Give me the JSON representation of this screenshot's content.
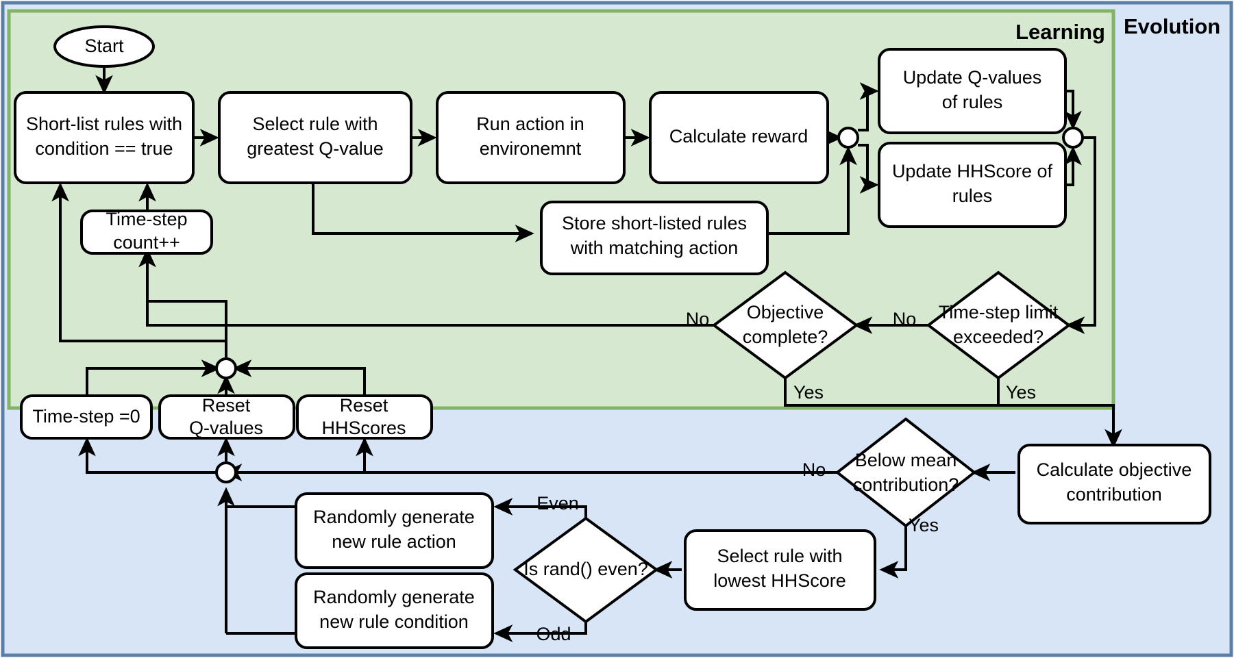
{
  "panels": {
    "learning": {
      "label": "Learning",
      "fill": "#d6e8d0",
      "stroke": "#82b366"
    },
    "evolution": {
      "label": "Evolution",
      "fill": "#d8e5f7",
      "stroke": "#5b7fa6"
    }
  },
  "nodes": {
    "start": "Start",
    "shortlist": {
      "l1": "Short-list rules with",
      "l2": "condition == true"
    },
    "select_rule": {
      "l1": "Select rule with",
      "l2": "greatest Q-value"
    },
    "run_action": {
      "l1": "Run action in",
      "l2": "environemnt"
    },
    "calc_reward": {
      "l1": "Calculate reward",
      "l2": ""
    },
    "update_q": {
      "l1": "Update Q-values",
      "l2": "of rules"
    },
    "update_hh": {
      "l1": "Update HHScore of",
      "l2": "rules"
    },
    "timestep_count": {
      "l1": "Time-step",
      "l2": "count++"
    },
    "store_rules": {
      "l1": "Store short-listed rules",
      "l2": "with matching action"
    },
    "objective_complete": {
      "l1": "Objective",
      "l2": "complete?"
    },
    "timestep_limit": {
      "l1": "Time-step limit",
      "l2": "exceeded?"
    },
    "timestep_zero": {
      "l1": "Time-step =0",
      "l2": ""
    },
    "reset_q": {
      "l1": "Reset",
      "l2": "Q-values"
    },
    "reset_hh": {
      "l1": "Reset",
      "l2": "HHScores"
    },
    "calc_objective": {
      "l1": "Calculate objective",
      "l2": "contribution"
    },
    "below_mean": {
      "l1": "Below mean",
      "l2": "contribution?"
    },
    "select_lowest": {
      "l1": "Select rule with",
      "l2": "lowest HHScore"
    },
    "is_rand_even": {
      "l1": "Is rand() even?",
      "l2": ""
    },
    "gen_action": {
      "l1": "Randomly generate",
      "l2": "new rule action"
    },
    "gen_condition": {
      "l1": "Randomly generate",
      "l2": "new rule condition"
    }
  },
  "edge_labels": {
    "objective_no": "No",
    "timestep_no": "No",
    "objective_yes": "Yes",
    "timestep_yes": "Yes",
    "belowmean_no": "No",
    "belowmean_yes": "Yes",
    "rand_even": "Even",
    "rand_odd": "Odd"
  }
}
